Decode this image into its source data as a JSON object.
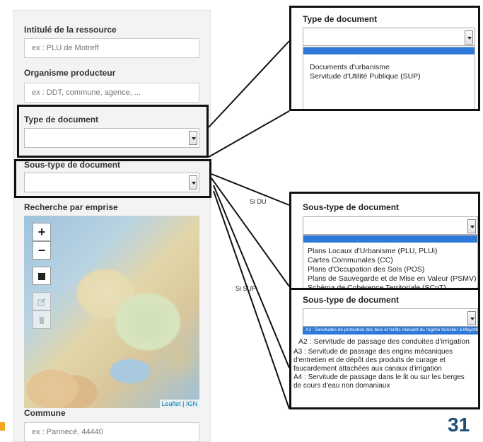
{
  "form": {
    "resource_title_label": "Intitulé de la ressource",
    "resource_title_placeholder": "ex : PLU de Motreff",
    "producer_label": "Organisme producteur",
    "producer_placeholder": "ex : DDT, commune, agence, ...",
    "doc_type_label": "Type de document",
    "doc_subtype_label": "Sous-type de document",
    "bbox_search_label": "Recherche par emprise",
    "commune_label": "Commune",
    "commune_placeholder": "ex : Pannecé, 44440"
  },
  "map": {
    "zoom_in": "+",
    "zoom_out": "−",
    "attribution": "Leaflet | IGN"
  },
  "popup_type": {
    "title": "Type de document",
    "options": [
      "Documents d'urbanisme",
      "Servitude d'Utilité Publique (SUP)"
    ]
  },
  "popup_du": {
    "title": "Sous-type de document",
    "condition": "Si DU",
    "options": [
      "Plans Locaux d'Urbanisme (PLU, PLUi)",
      "Cartes Communales (CC)",
      "Plans d'Occupation des Sols (POS)",
      "Plans de Sauvegarde et de Mise en Valeur (PSMV)",
      "Schéma de Cohérence Territoriale (SCoT)"
    ]
  },
  "popup_sup": {
    "title": "Sous-type de document",
    "condition": "Si SUP",
    "highlighted_option": "A1 : Servitudes de protection des bois et forêts relevant du régime forestier à Mayotte",
    "options": [
      "A2 : Servitude de passage des conduites d'irrigation",
      "A3 : Servitude de passage des engins mécaniques d'entretien et de dépôt des produits de curage et faucardement attachées aux canaux d'irrigation",
      "A4 : Servitude de passage dans le lit ou sur les berges de cours d'eau non domaniaux"
    ]
  },
  "slide": {
    "page_number": "31"
  }
}
